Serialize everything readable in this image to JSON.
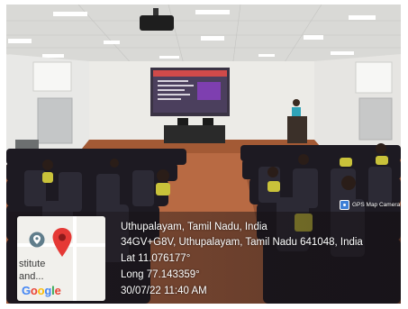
{
  "camera_badge": {
    "label": "GPS Map Camera",
    "icon": "camera-icon"
  },
  "map": {
    "place_label": "stitute\nand...",
    "google_logo": "Google",
    "icons": [
      "place-icon",
      "location-pin-icon"
    ],
    "colors": {
      "pin_red": "#e53935",
      "pin_grey": "#607d8b"
    }
  },
  "location": {
    "title": "Uthupalayam, Tamil Nadu, India",
    "address": "34GV+G8V, Uthupalayam, Tamil Nadu 641048, India",
    "latitude": "Lat 11.076177°",
    "longitude": "Long 77.143359°",
    "datetime": "30/07/22 11:40 AM"
  }
}
